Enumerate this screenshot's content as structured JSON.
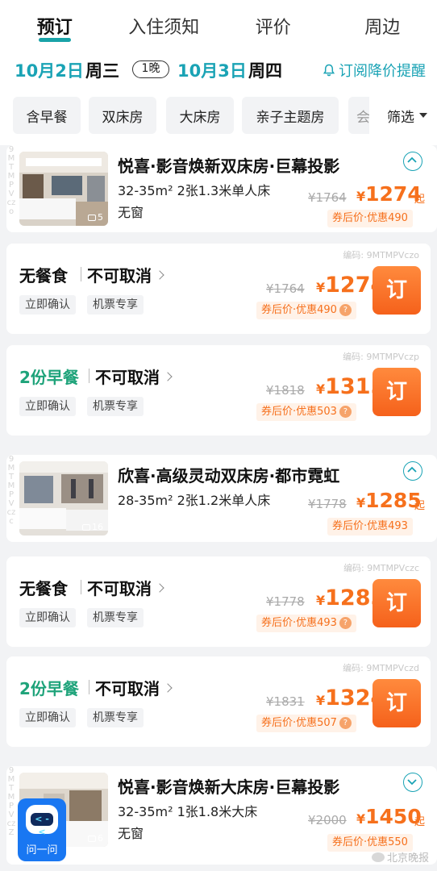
{
  "tabs": [
    {
      "label": "预订",
      "active": true
    },
    {
      "label": "入住须知",
      "active": false
    },
    {
      "label": "评价",
      "active": false
    },
    {
      "label": "周边",
      "active": false
    }
  ],
  "dates": {
    "checkin": "10月2日",
    "checkin_weekday": "周三",
    "nights": "1晚",
    "checkout": "10月3日",
    "checkout_weekday": "周四",
    "price_alert": "订阅降价提醒"
  },
  "filters": {
    "chips": [
      "含早餐",
      "双床房",
      "大床房",
      "亲子主题房",
      "会"
    ],
    "filter_label": "筛选"
  },
  "colors": {
    "accent": "#1aa3b5",
    "price": "#f6701c",
    "green": "#1ea37a",
    "book_button": "#f5611b"
  },
  "rooms": [
    {
      "vcode": "9MTMPVczo",
      "title": "悦喜·影音焕新双床房·巨幕投影",
      "spec": "32-35m²   2张1.3米单人床",
      "window": "无窗",
      "photo_count": "5",
      "orig_price": "¥1764",
      "yen": "¥",
      "price": "1274",
      "qi": "起",
      "after": "券后价·优惠490",
      "expanded": true
    },
    {
      "vcode": "9MTMPVczc",
      "title": "欣喜·高级灵动双床房·都市霓虹",
      "spec": "28-35m²   2张1.2米单人床",
      "window": "",
      "photo_count": "16",
      "orig_price": "¥1778",
      "yen": "¥",
      "price": "1285",
      "qi": "起",
      "after": "券后价·优惠493",
      "expanded": true
    },
    {
      "vcode": "9MTMPVczZ",
      "title": "悦喜·影音焕新大床房·巨幕投影",
      "spec": "32-35m²   1张1.8米大床",
      "window": "无窗",
      "photo_count": "6",
      "orig_price": "¥2000",
      "yen": "¥",
      "price": "1450",
      "qi": "起",
      "after": "券后价·优惠550",
      "expanded": false
    }
  ],
  "rates": [
    {
      "code": "编码: 9MTMPVczo",
      "meal": "无餐食",
      "cancel": "不可取消",
      "badges": [
        "立即确认",
        "机票专享"
      ],
      "orig": "¥1764",
      "yen": "¥",
      "price": "1274",
      "after": "券后价·优惠490",
      "book": "订"
    },
    {
      "code": "编码: 9MTMPVczp",
      "meal": "2份早餐",
      "cancel": "不可取消",
      "badges": [
        "立即确认",
        "机票专享"
      ],
      "orig": "¥1818",
      "yen": "¥",
      "price": "1315",
      "after": "券后价·优惠503",
      "book": "订"
    },
    {
      "code": "编码: 9MTMPVczc",
      "meal": "无餐食",
      "cancel": "不可取消",
      "badges": [
        "立即确认",
        "机票专享"
      ],
      "orig": "¥1778",
      "yen": "¥",
      "price": "1285",
      "after": "券后价·优惠493",
      "book": "订"
    },
    {
      "code": "编码: 9MTMPVczd",
      "meal": "2份早餐",
      "cancel": "不可取消",
      "badges": [
        "立即确认",
        "机票专享"
      ],
      "orig": "¥1831",
      "yen": "¥",
      "price": "1324",
      "after": "券后价·优惠507",
      "book": "订"
    }
  ],
  "assistant": {
    "label": "问一问",
    "eyes": "< - <"
  },
  "watermark": "北京晚报",
  "qmark": "?"
}
